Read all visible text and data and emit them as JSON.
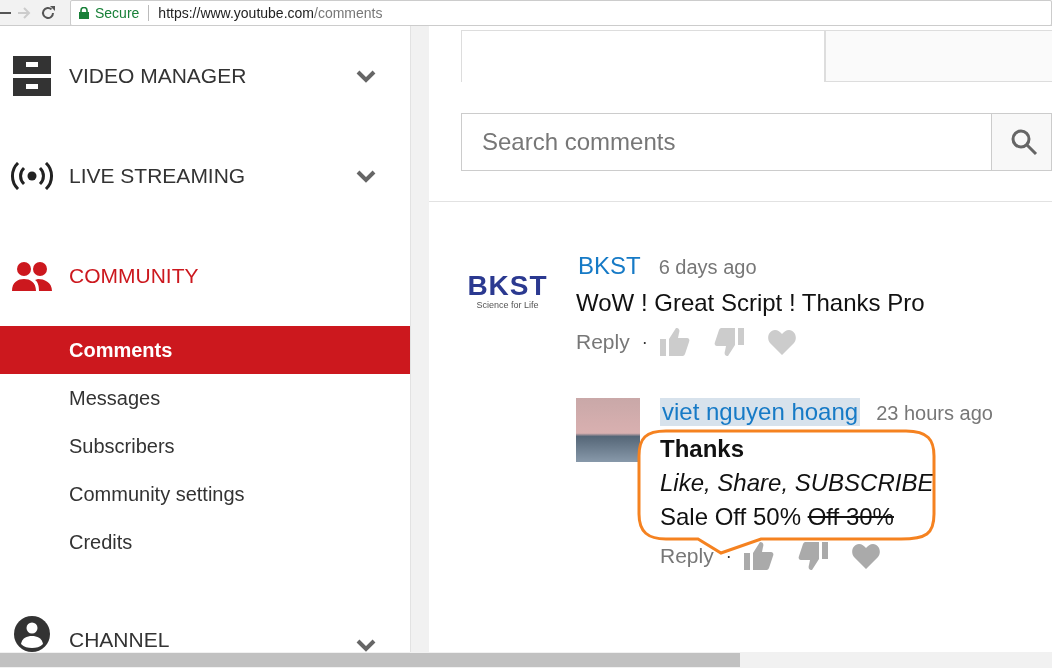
{
  "browser": {
    "secure_label": "Secure",
    "url_host": "https://www.youtube.com",
    "url_path": "/comments"
  },
  "sidebar": {
    "sections": [
      {
        "label": "VIDEO MANAGER",
        "active": false,
        "expanded": false
      },
      {
        "label": "LIVE STREAMING",
        "active": false,
        "expanded": false
      },
      {
        "label": "COMMUNITY",
        "active": true,
        "expanded": true,
        "children": [
          {
            "label": "Comments",
            "selected": true
          },
          {
            "label": "Messages",
            "selected": false
          },
          {
            "label": "Subscribers",
            "selected": false
          },
          {
            "label": "Community settings",
            "selected": false
          },
          {
            "label": "Credits",
            "selected": false
          }
        ]
      },
      {
        "label": "CHANNEL",
        "active": false,
        "expanded": false
      }
    ]
  },
  "search": {
    "placeholder": "Search comments"
  },
  "comments": [
    {
      "author": "BKST",
      "highlighted": false,
      "time": "6 days ago",
      "avatar": {
        "kind": "logo",
        "title": "BKST",
        "tagline": "Science for Life"
      },
      "lines": [
        {
          "bold": false,
          "italic": false,
          "segments": [
            {
              "text": "WoW ! Great Script ! Thanks Pro",
              "struck": false
            }
          ]
        }
      ],
      "reply_label": "Reply",
      "separator": "·",
      "replies": [
        {
          "author": "viet nguyen hoang",
          "highlighted": true,
          "time": "23 hours ago",
          "avatar": {
            "kind": "photo"
          },
          "lines": [
            {
              "bold": true,
              "italic": false,
              "segments": [
                {
                  "text": "Thanks",
                  "struck": false
                }
              ]
            },
            {
              "bold": false,
              "italic": true,
              "segments": [
                {
                  "text": "Like, Share, SUBSCRIBE",
                  "struck": false
                }
              ]
            },
            {
              "bold": false,
              "italic": false,
              "segments": [
                {
                  "text": "Sale Off 50%",
                  "struck": false
                },
                {
                  "text": "Off 30%",
                  "struck": true
                }
              ]
            }
          ],
          "reply_label": "Reply",
          "separator": "·",
          "annotated": true
        }
      ]
    }
  ]
}
